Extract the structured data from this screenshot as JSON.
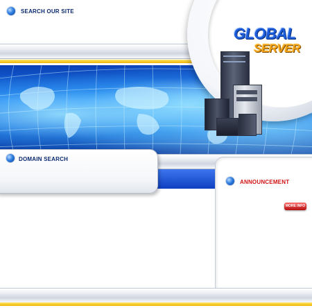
{
  "header": {
    "search_label": "SEARCH OUR SITE"
  },
  "logo": {
    "line1": "GLOBAL",
    "line2": "SERVER"
  },
  "panels": {
    "domain_search_label": "DOMAIN SEARCH",
    "announcement_label": "ANNOUNCEMENT",
    "more_info_label": "MORE INFO"
  },
  "colors": {
    "title_blue": "#0b2a6f",
    "announcement_red": "#d21414",
    "logo_blue": "#1c5cd8",
    "logo_orange": "#f2a214",
    "accent_yellow": "#f0b600"
  },
  "icons": {
    "bullet": "blue-orb-icon",
    "decoration": "server-rack-image"
  }
}
